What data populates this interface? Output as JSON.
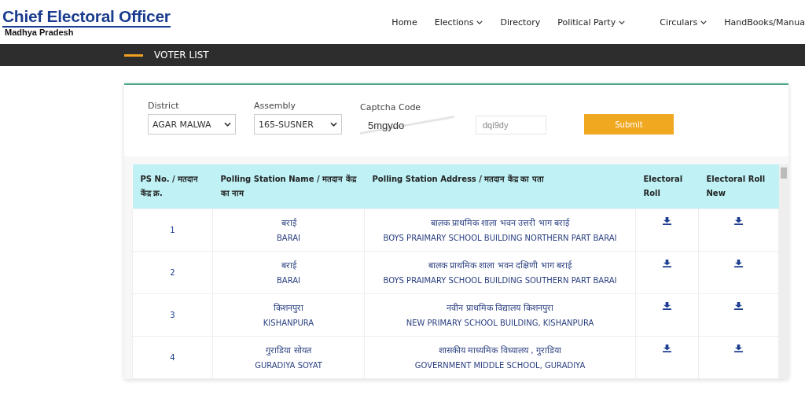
{
  "header": {
    "title": "Chief Electoral Officer",
    "subtitle": "Madhya Pradesh"
  },
  "nav": [
    {
      "label": "Home",
      "has_menu": false
    },
    {
      "label": "Elections",
      "has_menu": true
    },
    {
      "label": "Directory",
      "has_menu": false
    },
    {
      "label": "Political Party",
      "has_menu": true
    },
    {
      "label": "Circulars",
      "has_menu": true
    },
    {
      "label": "HandBooks/Manua",
      "has_menu": false
    }
  ],
  "page_bar": {
    "title": "VOTER LIST"
  },
  "form": {
    "district": {
      "label": "District",
      "value": "AGAR MALWA"
    },
    "assembly": {
      "label": "Assembly",
      "value": "165-SUSNER"
    },
    "captcha": {
      "label": "Captcha Code",
      "captcha_text": "5mgydo",
      "placeholder": "dqi9dy"
    },
    "submit": "Submit"
  },
  "table": {
    "columns": [
      "PS No. / मतदान केंद्र क्र.",
      "Polling Station Name / मतदान केंद्र का नाम",
      "Polling Station Address / मतदान केंद्र का पता",
      "Electoral Roll",
      "Electoral Roll New"
    ],
    "rows": [
      {
        "no": "1",
        "name_hi": "बराई",
        "name_en": "BARAI",
        "address_hi": "बालक प्राथमिक शाला भवन उत्तरी भाग बराई",
        "address_en": "BOYS PRAIMARY SCHOOL BUILDING NORTHERN PART BARAI"
      },
      {
        "no": "2",
        "name_hi": "बराई",
        "name_en": "BARAI",
        "address_hi": "बालक प्राथमिक शाला भवन दक्षिणी भाग बराई",
        "address_en": "BOYS PRAIMARY SCHOOL BUILDING SOUTHERN PART BARAI"
      },
      {
        "no": "3",
        "name_hi": "किशनपुरा",
        "name_en": "KISHANPURA",
        "address_hi": "नवीन प्राथमिक विद्यालय किशनपुरा",
        "address_en": "NEW PRIMARY SCHOOL BUILDING, KISHANPURA"
      },
      {
        "no": "4",
        "name_hi": "गुराडिया सोयत",
        "name_en": "GURADIYA SOYAT",
        "address_hi": "शासकीय माध्यमिक विध्यालय , गुराडिया",
        "address_en": "GOVERNMENT MIDDLE SCHOOL, GURADIYA"
      }
    ]
  }
}
